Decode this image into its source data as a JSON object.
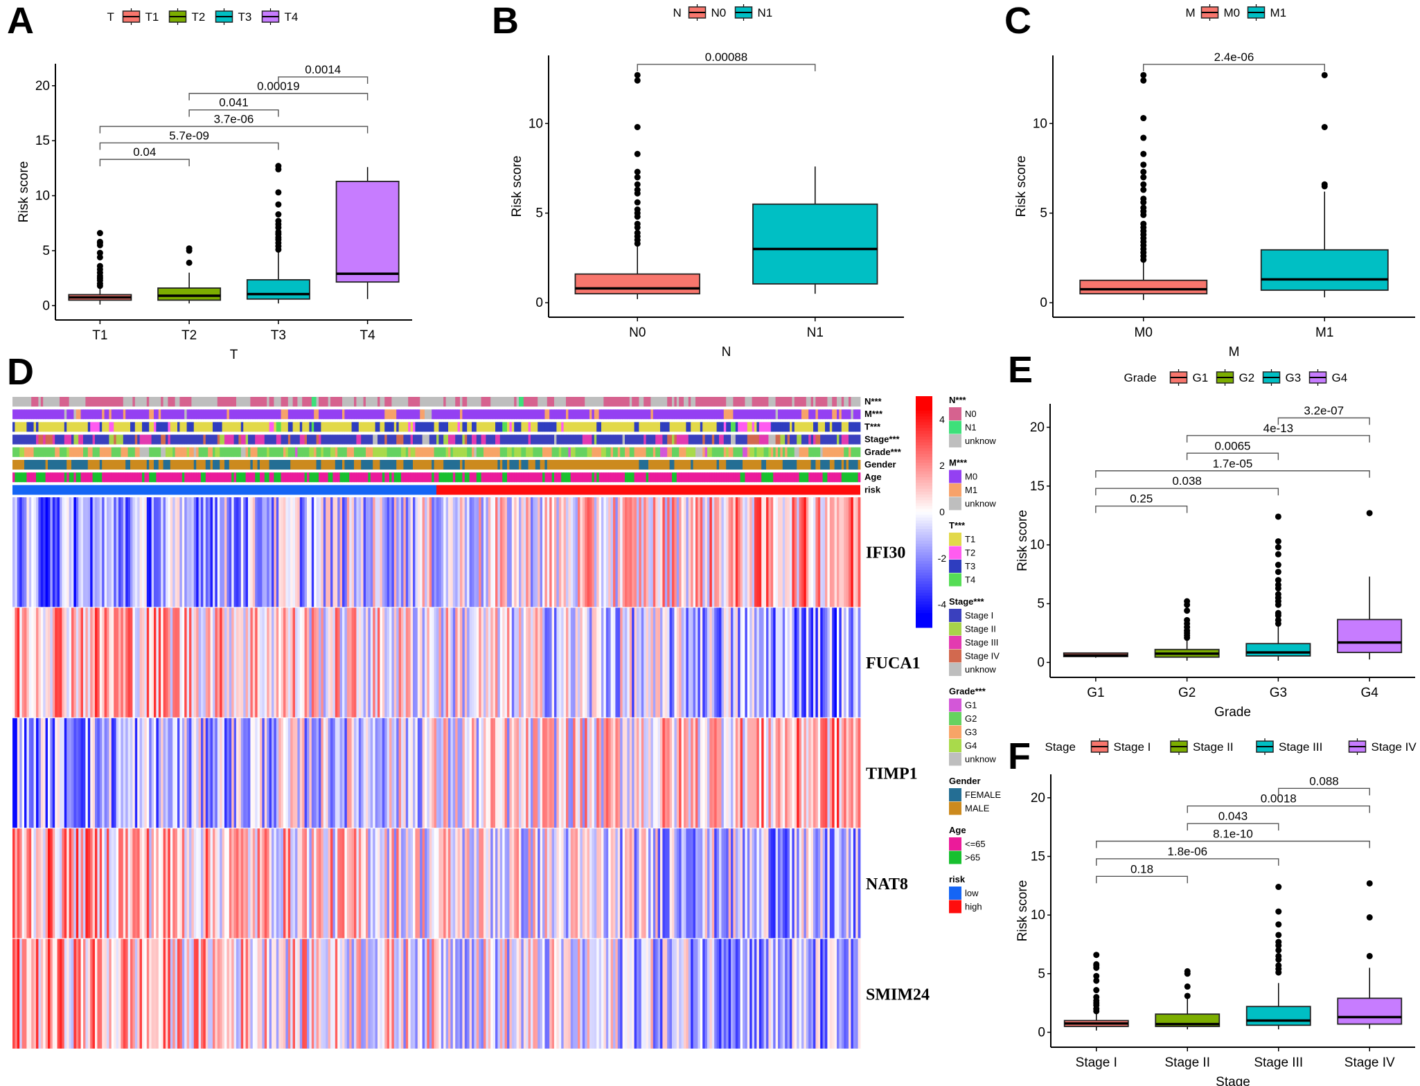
{
  "figure": {
    "panel_labels": [
      "A",
      "B",
      "C",
      "D",
      "E",
      "F"
    ]
  },
  "chart_data": [
    {
      "panel": "A",
      "type": "box",
      "legend_title": "T",
      "legend_position": "top",
      "categories": [
        "T1",
        "T2",
        "T3",
        "T4"
      ],
      "colors": [
        "#F8766D",
        "#7CAE00",
        "#00BFC4",
        "#C77CFF"
      ],
      "xlabel": "T",
      "ylabel": "Risk score",
      "ylim": [
        -0.8,
        22
      ],
      "yticks": [
        0,
        5,
        10,
        15,
        20
      ],
      "boxes": [
        {
          "q1": 0.5,
          "median": 0.75,
          "q3": 1.0,
          "whisker_low": 0.1,
          "whisker_high": 1.6,
          "outliers": [
            1.8,
            2.0,
            2.3,
            2.5,
            2.7,
            3.0,
            3.3,
            3.6,
            4.4,
            4.8,
            5.5,
            5.7,
            5.8,
            6.6
          ]
        },
        {
          "q1": 0.5,
          "median": 0.9,
          "q3": 1.6,
          "whisker_low": 0.2,
          "whisker_high": 3.0,
          "outliers": [
            3.9,
            5.0,
            5.2
          ]
        },
        {
          "q1": 0.6,
          "median": 1.05,
          "q3": 2.35,
          "whisker_low": 0.2,
          "whisker_high": 5.0,
          "outliers": [
            5.1,
            5.4,
            5.7,
            6.0,
            6.2,
            6.5,
            6.7,
            7.1,
            7.4,
            7.7,
            8.3,
            9.2,
            10.3,
            12.4,
            12.7
          ]
        },
        {
          "q1": 2.15,
          "median": 2.9,
          "q3": 11.3,
          "whisker_low": 0.6,
          "whisker_high": 12.6,
          "outliers": []
        }
      ],
      "comparisons": [
        {
          "from": 0,
          "to": 1,
          "label": "0.04",
          "y": 13.3
        },
        {
          "from": 0,
          "to": 2,
          "label": "5.7e-09",
          "y": 14.8
        },
        {
          "from": 0,
          "to": 3,
          "label": "3.7e-06",
          "y": 16.3
        },
        {
          "from": 1,
          "to": 2,
          "label": "0.041",
          "y": 17.8
        },
        {
          "from": 1,
          "to": 3,
          "label": "0.00019",
          "y": 19.3
        },
        {
          "from": 2,
          "to": 3,
          "label": "0.0014",
          "y": 20.8
        }
      ]
    },
    {
      "panel": "B",
      "type": "box",
      "legend_title": "N",
      "legend_position": "top",
      "categories": [
        "N0",
        "N1"
      ],
      "colors": [
        "#F8766D",
        "#00BFC4"
      ],
      "xlabel": "N",
      "ylabel": "Risk score",
      "ylim": [
        -0.5,
        13.8
      ],
      "yticks": [
        0,
        5,
        10
      ],
      "boxes": [
        {
          "q1": 0.5,
          "median": 0.8,
          "q3": 1.6,
          "whisker_low": 0.2,
          "whisker_high": 3.2,
          "outliers": [
            3.3,
            3.5,
            3.7,
            3.9,
            4.2,
            4.4,
            4.8,
            5.0,
            5.2,
            5.6,
            6.1,
            6.3,
            6.6,
            7.0,
            7.3,
            8.3,
            9.8,
            12.4,
            12.7
          ]
        },
        {
          "q1": 1.05,
          "median": 3.0,
          "q3": 5.5,
          "whisker_low": 0.5,
          "whisker_high": 7.6,
          "outliers": []
        }
      ],
      "comparisons": [
        {
          "from": 0,
          "to": 1,
          "label": "0.00088",
          "y": 13.3
        }
      ]
    },
    {
      "panel": "C",
      "type": "box",
      "legend_title": "M",
      "legend_position": "top",
      "categories": [
        "M0",
        "M1"
      ],
      "colors": [
        "#F8766D",
        "#00BFC4"
      ],
      "xlabel": "M",
      "ylabel": "Risk score",
      "ylim": [
        -0.5,
        13.8
      ],
      "yticks": [
        0,
        5,
        10
      ],
      "boxes": [
        {
          "q1": 0.5,
          "median": 0.75,
          "q3": 1.25,
          "whisker_low": 0.15,
          "whisker_high": 2.3,
          "outliers": [
            2.4,
            2.6,
            2.8,
            3.0,
            3.2,
            3.4,
            3.6,
            3.8,
            4.0,
            4.2,
            4.4,
            4.9,
            5.1,
            5.3,
            5.6,
            5.8,
            6.3,
            6.6,
            7.0,
            7.3,
            7.7,
            8.3,
            9.2,
            10.3,
            12.4,
            12.7
          ]
        },
        {
          "q1": 0.7,
          "median": 1.3,
          "q3": 2.95,
          "whisker_low": 0.3,
          "whisker_high": 6.2,
          "outliers": [
            6.5,
            6.6,
            9.8,
            12.7
          ]
        }
      ],
      "comparisons": [
        {
          "from": 0,
          "to": 1,
          "label": "2.4e-06",
          "y": 13.3
        }
      ]
    },
    {
      "panel": "D",
      "type": "heatmap",
      "genes": [
        "IFI30",
        "FUCA1",
        "TIMP1",
        "NAT8",
        "SMIM24"
      ],
      "annotation_tracks": [
        "N***",
        "M***",
        "T***",
        "Stage***",
        "Grade***",
        "Gender",
        "Age",
        "risk"
      ],
      "risk_split_fraction": 0.5,
      "colorbar": {
        "min": -5,
        "max": 5,
        "ticks": [
          4,
          2,
          0,
          -2,
          -4
        ],
        "low_color": "#0000FF",
        "mid_color": "#FFFFFF",
        "high_color": "#FF0000"
      },
      "gene_trend": [
        {
          "gene": "IFI30",
          "low_risk": -2.2,
          "high_risk": 1.8
        },
        {
          "gene": "FUCA1",
          "low_risk": 1.8,
          "high_risk": -2.0
        },
        {
          "gene": "TIMP1",
          "low_risk": -1.8,
          "high_risk": 1.6
        },
        {
          "gene": "NAT8",
          "low_risk": 1.6,
          "high_risk": -1.6
        },
        {
          "gene": "SMIM24",
          "low_risk": 1.5,
          "high_risk": -1.8
        }
      ],
      "legend": [
        {
          "title": "N***",
          "items": [
            {
              "label": "N0",
              "color": "#D6628F"
            },
            {
              "label": "N1",
              "color": "#3EE07A"
            },
            {
              "label": "unknow",
              "color": "#BEBEBE"
            }
          ]
        },
        {
          "title": "M***",
          "items": [
            {
              "label": "M0",
              "color": "#9440F2"
            },
            {
              "label": "M1",
              "color": "#F7A26A"
            },
            {
              "label": "unknow",
              "color": "#BEBEBE"
            }
          ]
        },
        {
          "title": "T***",
          "items": [
            {
              "label": "T1",
              "color": "#E2D94A"
            },
            {
              "label": "T2",
              "color": "#FF5CF0"
            },
            {
              "label": "T3",
              "color": "#2E3DBF"
            },
            {
              "label": "T4",
              "color": "#55DD55"
            }
          ]
        },
        {
          "title": "Stage***",
          "items": [
            {
              "label": "Stage I",
              "color": "#3A40BE"
            },
            {
              "label": "Stage II",
              "color": "#A8D24A"
            },
            {
              "label": "Stage III",
              "color": "#E33AB0"
            },
            {
              "label": "Stage IV",
              "color": "#D2694F"
            },
            {
              "label": "unknow",
              "color": "#BEBEBE"
            }
          ]
        },
        {
          "title": "Grade***",
          "items": [
            {
              "label": "G1",
              "color": "#D357D8"
            },
            {
              "label": "G2",
              "color": "#66D260"
            },
            {
              "label": "G3",
              "color": "#F7A467"
            },
            {
              "label": "G4",
              "color": "#A9DA4B"
            },
            {
              "label": "unknow",
              "color": "#BEBEBE"
            }
          ]
        },
        {
          "title": "Gender",
          "items": [
            {
              "label": "FEMALE",
              "color": "#246E94"
            },
            {
              "label": "MALE",
              "color": "#CC8A1E"
            }
          ]
        },
        {
          "title": "Age",
          "items": [
            {
              "label": "<=65",
              "color": "#EB1B9A"
            },
            {
              "label": ">65",
              "color": "#18C02F"
            }
          ]
        },
        {
          "title": "risk",
          "items": [
            {
              "label": "low",
              "color": "#1565F5"
            },
            {
              "label": "high",
              "color": "#FF0D0D"
            }
          ]
        }
      ]
    },
    {
      "panel": "E",
      "type": "box",
      "legend_title": "Grade",
      "legend_position": "top",
      "categories": [
        "G1",
        "G2",
        "G3",
        "G4"
      ],
      "colors": [
        "#F8766D",
        "#7CAE00",
        "#00BFC4",
        "#C77CFF"
      ],
      "xlabel": "Grade",
      "ylabel": "Risk score",
      "ylim": [
        -0.8,
        22
      ],
      "yticks": [
        0,
        5,
        10,
        15,
        20
      ],
      "boxes": [
        {
          "q1": 0.5,
          "median": 0.6,
          "q3": 0.8,
          "whisker_low": 0.4,
          "whisker_high": 0.85,
          "outliers": []
        },
        {
          "q1": 0.45,
          "median": 0.75,
          "q3": 1.1,
          "whisker_low": 0.15,
          "whisker_high": 1.9,
          "outliers": [
            2.1,
            2.3,
            2.5,
            2.7,
            3.0,
            3.3,
            3.6,
            4.4,
            4.9,
            5.2
          ]
        },
        {
          "q1": 0.55,
          "median": 0.85,
          "q3": 1.6,
          "whisker_low": 0.15,
          "whisker_high": 3.1,
          "outliers": [
            3.3,
            3.6,
            4.0,
            4.2,
            4.9,
            5.2,
            5.5,
            5.8,
            6.3,
            6.6,
            7.0,
            7.7,
            8.3,
            9.2,
            9.8,
            10.3,
            12.4
          ]
        },
        {
          "q1": 0.85,
          "median": 1.7,
          "q3": 3.65,
          "whisker_low": 0.25,
          "whisker_high": 7.3,
          "outliers": [
            12.7
          ]
        }
      ],
      "comparisons": [
        {
          "from": 0,
          "to": 1,
          "label": "0.25",
          "y": 13.3
        },
        {
          "from": 0,
          "to": 2,
          "label": "0.038",
          "y": 14.8
        },
        {
          "from": 0,
          "to": 3,
          "label": "1.7e-05",
          "y": 16.3
        },
        {
          "from": 1,
          "to": 2,
          "label": "0.0065",
          "y": 17.8
        },
        {
          "from": 1,
          "to": 3,
          "label": "4e-13",
          "y": 19.3
        },
        {
          "from": 2,
          "to": 3,
          "label": "3.2e-07",
          "y": 20.8
        }
      ]
    },
    {
      "panel": "F",
      "type": "box",
      "legend_title": "Stage",
      "legend_position": "top",
      "categories": [
        "Stage I",
        "Stage II",
        "Stage III",
        "Stage IV"
      ],
      "colors": [
        "#F8766D",
        "#7CAE00",
        "#00BFC4",
        "#C77CFF"
      ],
      "xlabel": "Stage",
      "ylabel": "Risk score",
      "ylim": [
        -0.8,
        22
      ],
      "yticks": [
        0,
        5,
        10,
        15,
        20
      ],
      "boxes": [
        {
          "q1": 0.5,
          "median": 0.75,
          "q3": 1.0,
          "whisker_low": 0.15,
          "whisker_high": 1.7,
          "outliers": [
            1.8,
            2.0,
            2.3,
            2.5,
            2.7,
            3.0,
            3.6,
            4.4,
            4.8,
            5.5,
            5.7,
            5.8,
            6.6
          ]
        },
        {
          "q1": 0.5,
          "median": 0.7,
          "q3": 1.55,
          "whisker_low": 0.25,
          "whisker_high": 3.0,
          "outliers": [
            3.1,
            3.9,
            5.0,
            5.2
          ]
        },
        {
          "q1": 0.6,
          "median": 1.0,
          "q3": 2.2,
          "whisker_low": 0.25,
          "whisker_high": 4.2,
          "outliers": [
            5.1,
            5.4,
            5.7,
            6.2,
            6.5,
            7.0,
            7.4,
            7.7,
            8.3,
            9.2,
            10.3,
            12.4
          ]
        },
        {
          "q1": 0.7,
          "median": 1.3,
          "q3": 2.9,
          "whisker_low": 0.3,
          "whisker_high": 5.5,
          "outliers": [
            6.5,
            9.8,
            12.7
          ]
        }
      ],
      "comparisons": [
        {
          "from": 0,
          "to": 1,
          "label": "0.18",
          "y": 13.3
        },
        {
          "from": 0,
          "to": 2,
          "label": "1.8e-06",
          "y": 14.8
        },
        {
          "from": 0,
          "to": 3,
          "label": "8.1e-10",
          "y": 16.3
        },
        {
          "from": 1,
          "to": 2,
          "label": "0.043",
          "y": 17.8
        },
        {
          "from": 1,
          "to": 3,
          "label": "0.0018",
          "y": 19.3
        },
        {
          "from": 2,
          "to": 3,
          "label": "0.088",
          "y": 20.8
        }
      ]
    }
  ]
}
